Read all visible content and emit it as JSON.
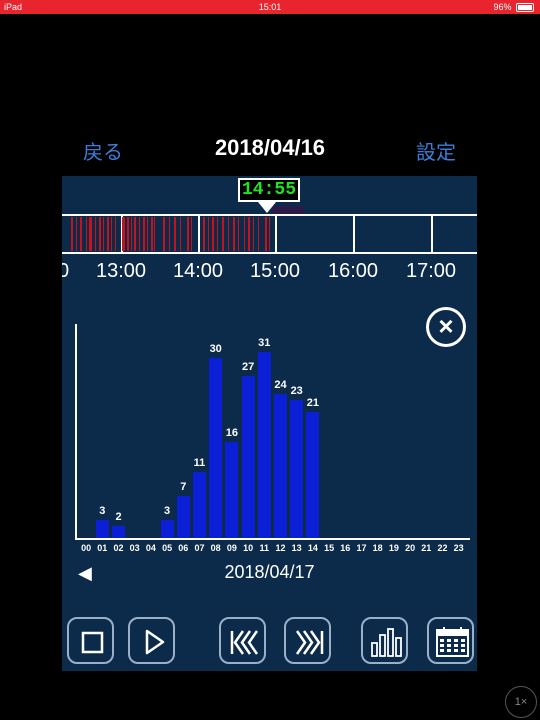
{
  "status_bar": {
    "device": "iPad",
    "time": "15:01",
    "battery": "96%"
  },
  "nav": {
    "back": "戻る",
    "title": "2018/04/16",
    "settings": "設定"
  },
  "timeline": {
    "current_time": "14:55",
    "hour_labels": [
      "0",
      "13:00",
      "14:00",
      "15:00",
      "16:00",
      "17:00"
    ]
  },
  "chart_data": {
    "type": "bar",
    "title": "",
    "categories": [
      "00",
      "01",
      "02",
      "03",
      "04",
      "05",
      "06",
      "07",
      "08",
      "09",
      "10",
      "11",
      "12",
      "13",
      "14",
      "15",
      "16",
      "17",
      "18",
      "19",
      "20",
      "21",
      "22",
      "23"
    ],
    "values": [
      0,
      3,
      2,
      0,
      0,
      3,
      7,
      11,
      30,
      16,
      27,
      31,
      24,
      23,
      21,
      0,
      0,
      0,
      0,
      0,
      0,
      0,
      0,
      0
    ],
    "data_labels": [
      "",
      "3",
      "2",
      "",
      "",
      "3",
      "7",
      "11",
      "30",
      "16",
      "27",
      "31",
      "24",
      "23",
      "21",
      "",
      "",
      "",
      "",
      "",
      "",
      "",
      "",
      ""
    ],
    "ylim": [
      0,
      36
    ],
    "bar_color": "#0b1fd6"
  },
  "chart_nav": {
    "prev_arrow": "◀",
    "date": "2018/04/17"
  },
  "controls": [
    "stop-button",
    "play-button",
    "skip-back-button",
    "skip-forward-button",
    "chart-button",
    "calendar-button"
  ],
  "corner_badge": "1×",
  "colors": {
    "status_bar": "#e8252e",
    "panel": "#0c2a4a",
    "link": "#3b7dd8",
    "event_marks": "#c4131c",
    "clock_digits": "#1ee61e"
  }
}
